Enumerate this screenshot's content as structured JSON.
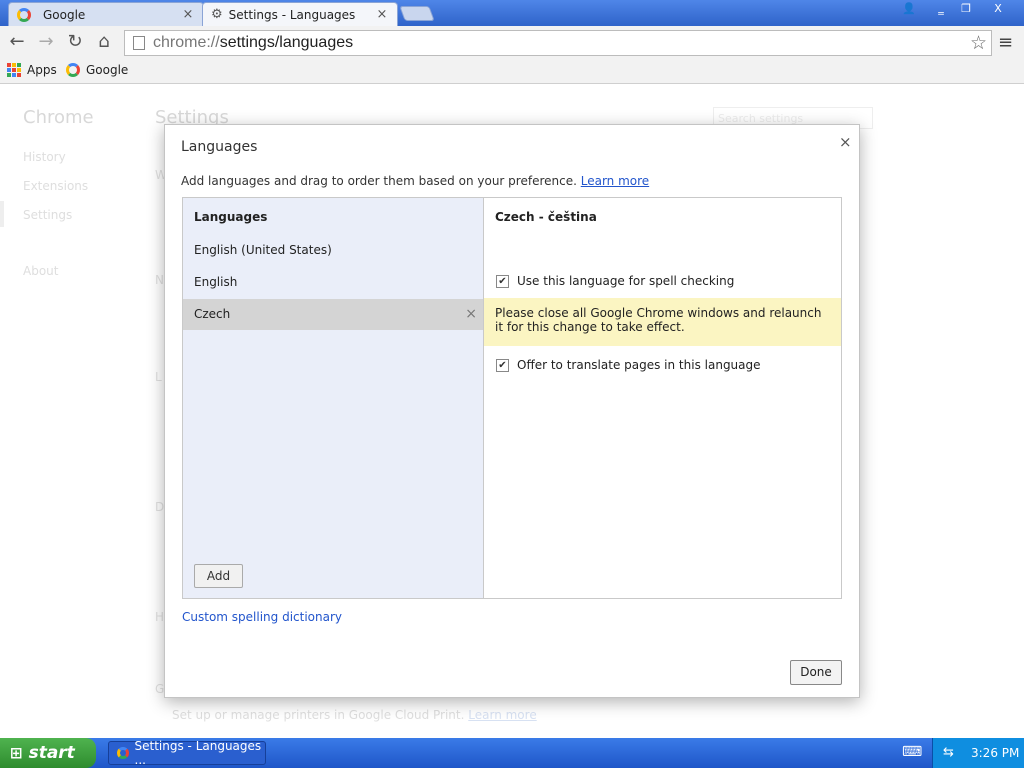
{
  "browser": {
    "tabs": [
      {
        "title": "Google",
        "close": "×"
      },
      {
        "title": "Settings - Languages",
        "close": "×"
      }
    ],
    "window_controls": {
      "user": "👤",
      "minimize": "‗",
      "maximize": "❐",
      "close": "X"
    },
    "url_prefix": "chrome://",
    "url_path": "settings/languages",
    "nav": {
      "back": "←",
      "forward": "→",
      "reload": "↻",
      "home": "⌂",
      "star": "☆",
      "menu": "≡"
    },
    "bookmarks": [
      {
        "label": "Apps"
      },
      {
        "label": "Google"
      }
    ]
  },
  "settings_page": {
    "sidebar_title": "Chrome",
    "sidebar_items": [
      "History",
      "Extensions",
      "Settings",
      "About"
    ],
    "main_title": "Settings",
    "search_placeholder": "Search settings",
    "section_letters": [
      "W",
      "N",
      "L",
      "D",
      "H",
      "G"
    ],
    "printer_text": "Set up or manage printers in Google Cloud Print.",
    "printer_link": "Learn more"
  },
  "dialog": {
    "title": "Languages",
    "close": "×",
    "description": "Add languages and drag to order them based on your preference.",
    "learn_more": "Learn more",
    "list_header": "Languages",
    "languages": [
      "English (United States)",
      "English",
      "Czech"
    ],
    "selected_language": "Czech",
    "remove": "×",
    "add_button": "Add",
    "detail_header": "Czech - čeština",
    "spell_check_label": "Use this language for spell checking",
    "spell_check_checked": true,
    "notice": "Please close all Google Chrome windows and relaunch it for this change to take effect.",
    "translate_label": "Offer to translate pages in this language",
    "translate_checked": true,
    "checkmark": "✔",
    "custom_dictionary": "Custom spelling dictionary",
    "done_button": "Done"
  },
  "taskbar": {
    "start_label": "start",
    "start_icon": "⊞",
    "task_label": "Settings - Languages ...",
    "tray_icon": "⇆",
    "keyboard_icon": "⌨",
    "time": "3:26 PM"
  },
  "colors": {
    "titlebar": "#2f63c9",
    "link": "#2255cc",
    "notice_bg": "#fbf5c2",
    "list_bg": "#eaeef9",
    "selected_row": "#d4d4d4",
    "start_green": "#2e8c2e"
  }
}
